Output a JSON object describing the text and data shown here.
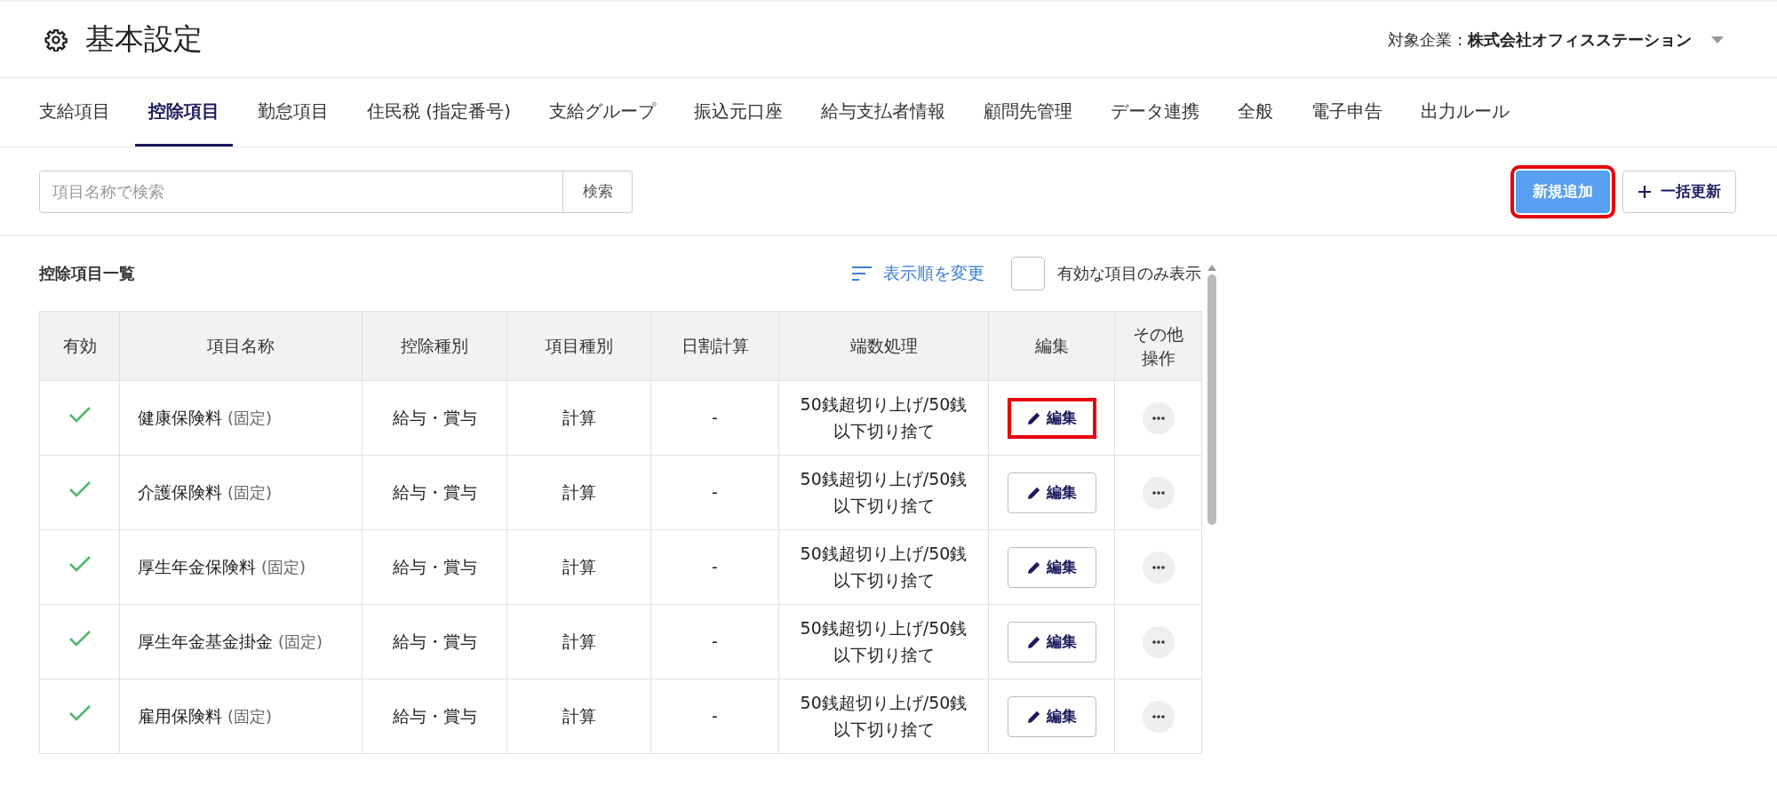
{
  "header": {
    "title": "基本設定",
    "company_label": "対象企業：",
    "company_name": "株式会社オフィスステーション"
  },
  "tabs": [
    {
      "label": "支給項目",
      "selected": false
    },
    {
      "label": "控除項目",
      "selected": true
    },
    {
      "label": "勤怠項目",
      "selected": false
    },
    {
      "label": "住民税 (指定番号)",
      "selected": false
    },
    {
      "label": "支給グループ",
      "selected": false
    },
    {
      "label": "振込元口座",
      "selected": false
    },
    {
      "label": "給与支払者情報",
      "selected": false
    },
    {
      "label": "顧問先管理",
      "selected": false
    },
    {
      "label": "データ連携",
      "selected": false
    },
    {
      "label": "全般",
      "selected": false
    },
    {
      "label": "電子申告",
      "selected": false
    },
    {
      "label": "出力ルール",
      "selected": false
    }
  ],
  "toolbar": {
    "search": {
      "placeholder": "項目名称で検索",
      "button": "検索"
    },
    "add_button": {
      "label": "新規追加",
      "highlighted": true
    },
    "bulk_button": {
      "label": "一括更新"
    }
  },
  "list": {
    "title": "控除項目一覧",
    "sort_link": "表示順を変更",
    "filter": {
      "label": "有効な項目のみ表示",
      "checked": false
    },
    "columns": [
      "有効",
      "項目名称",
      "控除種別",
      "項目種別",
      "日割計算",
      "端数処理",
      "編集",
      "その他操作"
    ],
    "rows": [
      {
        "enabled": true,
        "name": "健康保険料",
        "note": "(固定)",
        "deduction_type": "給与・賞与",
        "item_type": "計算",
        "daily": "-",
        "rounding": "50銭超切り上げ/50銭以下切り捨て",
        "edit": "編集",
        "edit_highlighted": true
      },
      {
        "enabled": true,
        "name": "介護保険料",
        "note": "(固定)",
        "deduction_type": "給与・賞与",
        "item_type": "計算",
        "daily": "-",
        "rounding": "50銭超切り上げ/50銭以下切り捨て",
        "edit": "編集",
        "edit_highlighted": false
      },
      {
        "enabled": true,
        "name": "厚生年金保険料",
        "note": "(固定)",
        "deduction_type": "給与・賞与",
        "item_type": "計算",
        "daily": "-",
        "rounding": "50銭超切り上げ/50銭以下切り捨て",
        "edit": "編集",
        "edit_highlighted": false
      },
      {
        "enabled": true,
        "name": "厚生年金基金掛金",
        "note": "(固定)",
        "deduction_type": "給与・賞与",
        "item_type": "計算",
        "daily": "-",
        "rounding": "50銭超切り上げ/50銭以下切り捨て",
        "edit": "編集",
        "edit_highlighted": false
      },
      {
        "enabled": true,
        "name": "雇用保険料",
        "note": "(固定)",
        "deduction_type": "給与・賞与",
        "item_type": "計算",
        "daily": "-",
        "rounding": "50銭超切り上げ/50銭以下切り捨て",
        "edit": "編集",
        "edit_highlighted": false
      }
    ]
  }
}
